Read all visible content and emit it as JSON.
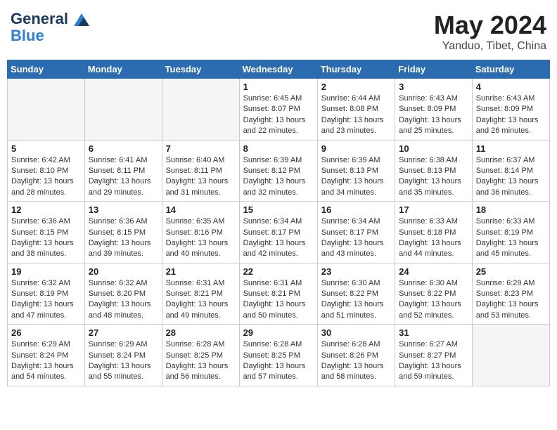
{
  "header": {
    "logo_line1": "General",
    "logo_line2": "Blue",
    "month": "May 2024",
    "location": "Yanduo, Tibet, China"
  },
  "weekdays": [
    "Sunday",
    "Monday",
    "Tuesday",
    "Wednesday",
    "Thursday",
    "Friday",
    "Saturday"
  ],
  "weeks": [
    [
      {
        "day": "",
        "info": ""
      },
      {
        "day": "",
        "info": ""
      },
      {
        "day": "",
        "info": ""
      },
      {
        "day": "1",
        "info": "Sunrise: 6:45 AM\nSunset: 8:07 PM\nDaylight: 13 hours\nand 22 minutes."
      },
      {
        "day": "2",
        "info": "Sunrise: 6:44 AM\nSunset: 8:08 PM\nDaylight: 13 hours\nand 23 minutes."
      },
      {
        "day": "3",
        "info": "Sunrise: 6:43 AM\nSunset: 8:09 PM\nDaylight: 13 hours\nand 25 minutes."
      },
      {
        "day": "4",
        "info": "Sunrise: 6:43 AM\nSunset: 8:09 PM\nDaylight: 13 hours\nand 26 minutes."
      }
    ],
    [
      {
        "day": "5",
        "info": "Sunrise: 6:42 AM\nSunset: 8:10 PM\nDaylight: 13 hours\nand 28 minutes."
      },
      {
        "day": "6",
        "info": "Sunrise: 6:41 AM\nSunset: 8:11 PM\nDaylight: 13 hours\nand 29 minutes."
      },
      {
        "day": "7",
        "info": "Sunrise: 6:40 AM\nSunset: 8:11 PM\nDaylight: 13 hours\nand 31 minutes."
      },
      {
        "day": "8",
        "info": "Sunrise: 6:39 AM\nSunset: 8:12 PM\nDaylight: 13 hours\nand 32 minutes."
      },
      {
        "day": "9",
        "info": "Sunrise: 6:39 AM\nSunset: 8:13 PM\nDaylight: 13 hours\nand 34 minutes."
      },
      {
        "day": "10",
        "info": "Sunrise: 6:38 AM\nSunset: 8:13 PM\nDaylight: 13 hours\nand 35 minutes."
      },
      {
        "day": "11",
        "info": "Sunrise: 6:37 AM\nSunset: 8:14 PM\nDaylight: 13 hours\nand 36 minutes."
      }
    ],
    [
      {
        "day": "12",
        "info": "Sunrise: 6:36 AM\nSunset: 8:15 PM\nDaylight: 13 hours\nand 38 minutes."
      },
      {
        "day": "13",
        "info": "Sunrise: 6:36 AM\nSunset: 8:15 PM\nDaylight: 13 hours\nand 39 minutes."
      },
      {
        "day": "14",
        "info": "Sunrise: 6:35 AM\nSunset: 8:16 PM\nDaylight: 13 hours\nand 40 minutes."
      },
      {
        "day": "15",
        "info": "Sunrise: 6:34 AM\nSunset: 8:17 PM\nDaylight: 13 hours\nand 42 minutes."
      },
      {
        "day": "16",
        "info": "Sunrise: 6:34 AM\nSunset: 8:17 PM\nDaylight: 13 hours\nand 43 minutes."
      },
      {
        "day": "17",
        "info": "Sunrise: 6:33 AM\nSunset: 8:18 PM\nDaylight: 13 hours\nand 44 minutes."
      },
      {
        "day": "18",
        "info": "Sunrise: 6:33 AM\nSunset: 8:19 PM\nDaylight: 13 hours\nand 45 minutes."
      }
    ],
    [
      {
        "day": "19",
        "info": "Sunrise: 6:32 AM\nSunset: 8:19 PM\nDaylight: 13 hours\nand 47 minutes."
      },
      {
        "day": "20",
        "info": "Sunrise: 6:32 AM\nSunset: 8:20 PM\nDaylight: 13 hours\nand 48 minutes."
      },
      {
        "day": "21",
        "info": "Sunrise: 6:31 AM\nSunset: 8:21 PM\nDaylight: 13 hours\nand 49 minutes."
      },
      {
        "day": "22",
        "info": "Sunrise: 6:31 AM\nSunset: 8:21 PM\nDaylight: 13 hours\nand 50 minutes."
      },
      {
        "day": "23",
        "info": "Sunrise: 6:30 AM\nSunset: 8:22 PM\nDaylight: 13 hours\nand 51 minutes."
      },
      {
        "day": "24",
        "info": "Sunrise: 6:30 AM\nSunset: 8:22 PM\nDaylight: 13 hours\nand 52 minutes."
      },
      {
        "day": "25",
        "info": "Sunrise: 6:29 AM\nSunset: 8:23 PM\nDaylight: 13 hours\nand 53 minutes."
      }
    ],
    [
      {
        "day": "26",
        "info": "Sunrise: 6:29 AM\nSunset: 8:24 PM\nDaylight: 13 hours\nand 54 minutes."
      },
      {
        "day": "27",
        "info": "Sunrise: 6:29 AM\nSunset: 8:24 PM\nDaylight: 13 hours\nand 55 minutes."
      },
      {
        "day": "28",
        "info": "Sunrise: 6:28 AM\nSunset: 8:25 PM\nDaylight: 13 hours\nand 56 minutes."
      },
      {
        "day": "29",
        "info": "Sunrise: 6:28 AM\nSunset: 8:25 PM\nDaylight: 13 hours\nand 57 minutes."
      },
      {
        "day": "30",
        "info": "Sunrise: 6:28 AM\nSunset: 8:26 PM\nDaylight: 13 hours\nand 58 minutes."
      },
      {
        "day": "31",
        "info": "Sunrise: 6:27 AM\nSunset: 8:27 PM\nDaylight: 13 hours\nand 59 minutes."
      },
      {
        "day": "",
        "info": ""
      }
    ]
  ]
}
